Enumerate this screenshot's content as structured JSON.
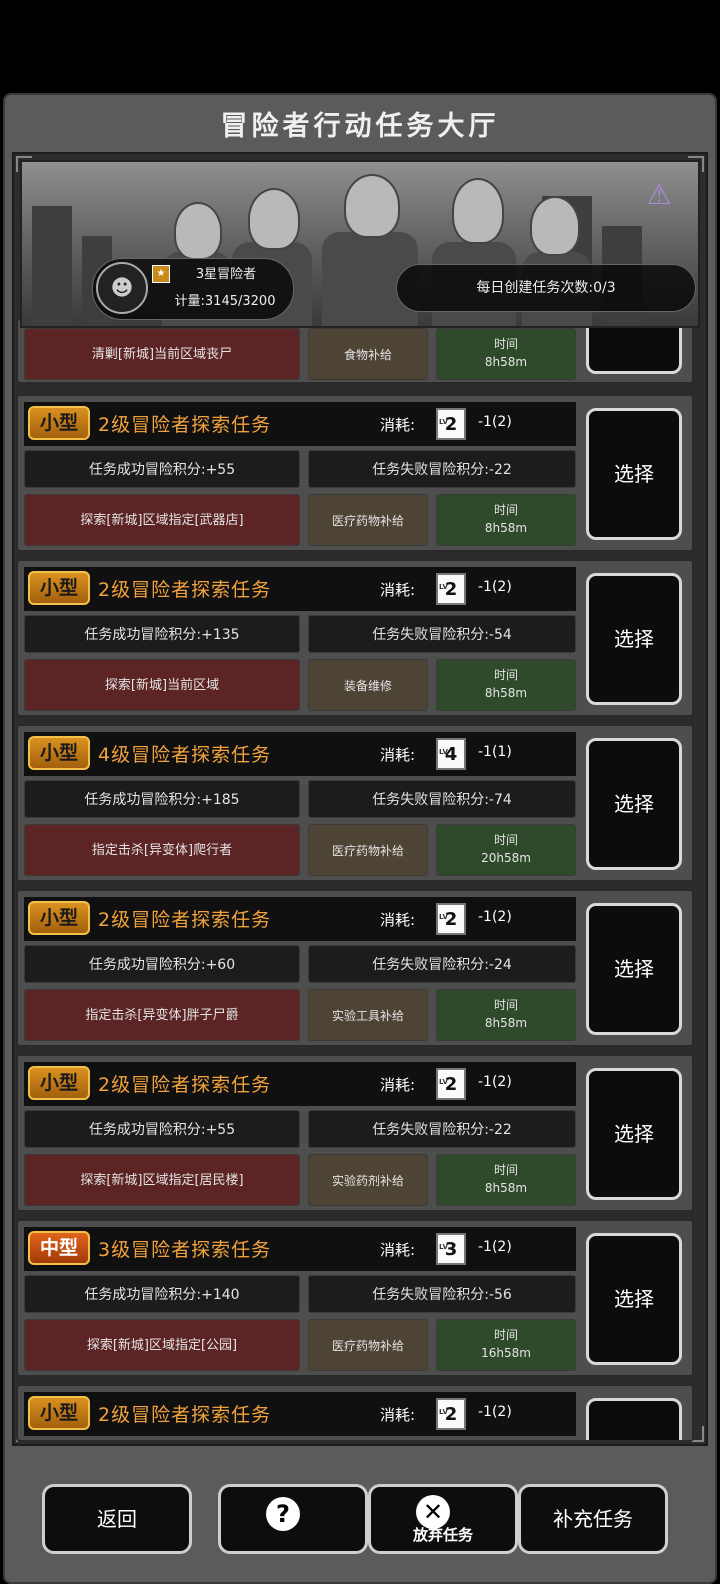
{
  "header": {
    "title": "冒险者行动任务大厅"
  },
  "banner": {
    "rank_name": "3星冒险者",
    "rank_counter": "计量:3145/3200",
    "daily_create": "每日创建任务次数:0/3"
  },
  "labels": {
    "cost": "消耗:",
    "time": "时间",
    "select": "选择"
  },
  "partial_task": {
    "target": "清剿[新城]当前区域丧尸",
    "reward": "食物补给",
    "time": "8h58m"
  },
  "tasks": [
    {
      "size": "小型",
      "title": "2级冒险者探索任务",
      "lv": "2",
      "cost": "-1(2)",
      "win": "任务成功冒险积分:+55",
      "fail": "任务失败冒险积分:-22",
      "target": "探索[新城]区域指定[武器店]",
      "reward": "医疗药物补给",
      "time": "8h58m"
    },
    {
      "size": "小型",
      "title": "2级冒险者探索任务",
      "lv": "2",
      "cost": "-1(2)",
      "win": "任务成功冒险积分:+135",
      "fail": "任务失败冒险积分:-54",
      "target": "探索[新城]当前区域",
      "reward": "装备维修",
      "time": "8h58m"
    },
    {
      "size": "小型",
      "title": "4级冒险者探索任务",
      "lv": "4",
      "cost": "-1(1)",
      "win": "任务成功冒险积分:+185",
      "fail": "任务失败冒险积分:-74",
      "target": "指定击杀[异变体]爬行者",
      "reward": "医疗药物补给",
      "time": "20h58m"
    },
    {
      "size": "小型",
      "title": "2级冒险者探索任务",
      "lv": "2",
      "cost": "-1(2)",
      "win": "任务成功冒险积分:+60",
      "fail": "任务失败冒险积分:-24",
      "target": "指定击杀[异变体]胖子尸爵",
      "reward": "实验工具补给",
      "time": "8h58m"
    },
    {
      "size": "小型",
      "title": "2级冒险者探索任务",
      "lv": "2",
      "cost": "-1(2)",
      "win": "任务成功冒险积分:+55",
      "fail": "任务失败冒险积分:-22",
      "target": "探索[新城]区域指定[居民楼]",
      "reward": "实验药剂补给",
      "time": "8h58m"
    },
    {
      "size": "中型",
      "title": "3级冒险者探索任务",
      "lv": "3",
      "cost": "-1(2)",
      "win": "任务成功冒险积分:+140",
      "fail": "任务失败冒险积分:-56",
      "target": "探索[新城]区域指定[公园]",
      "reward": "医疗药物补给",
      "time": "16h58m"
    },
    {
      "size": "小型",
      "title": "2级冒险者探索任务",
      "lv": "2",
      "cost": "-1(2)"
    }
  ],
  "nav": {
    "back": "返回",
    "abandon": "放弃任务",
    "supplement": "补充任务"
  },
  "colors": {
    "accent": "#f2a23c",
    "target_bg": "#5c2424",
    "time_bg": "#2e4a2a"
  }
}
